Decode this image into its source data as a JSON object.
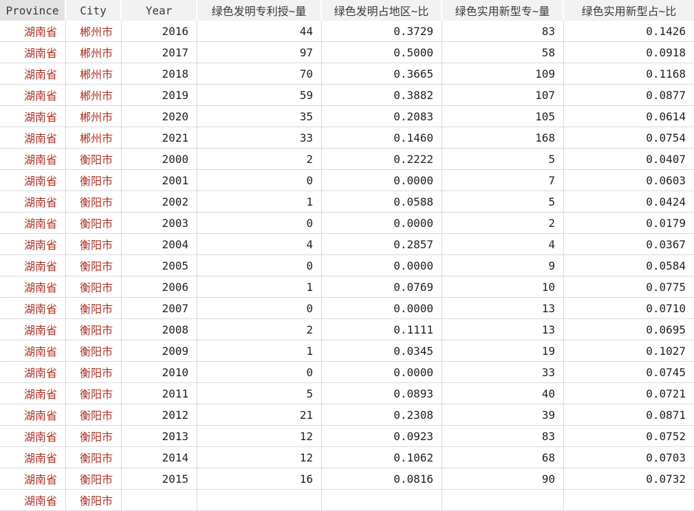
{
  "table": {
    "columns": [
      {
        "key": "province",
        "label": "Province"
      },
      {
        "key": "city",
        "label": "City"
      },
      {
        "key": "year",
        "label": "Year"
      },
      {
        "key": "green_invention_grants",
        "label": "绿色发明专利授~量"
      },
      {
        "key": "green_invention_share",
        "label": "绿色发明占地区~比"
      },
      {
        "key": "green_utility_grants",
        "label": "绿色实用新型专~量"
      },
      {
        "key": "green_utility_share",
        "label": "绿色实用新型占~比"
      }
    ],
    "rows": [
      {
        "province": "湖南省",
        "city": "郴州市",
        "year": "2016",
        "green_invention_grants": "44",
        "green_invention_share": "0.3729",
        "green_utility_grants": "83",
        "green_utility_share": "0.1426"
      },
      {
        "province": "湖南省",
        "city": "郴州市",
        "year": "2017",
        "green_invention_grants": "97",
        "green_invention_share": "0.5000",
        "green_utility_grants": "58",
        "green_utility_share": "0.0918"
      },
      {
        "province": "湖南省",
        "city": "郴州市",
        "year": "2018",
        "green_invention_grants": "70",
        "green_invention_share": "0.3665",
        "green_utility_grants": "109",
        "green_utility_share": "0.1168"
      },
      {
        "province": "湖南省",
        "city": "郴州市",
        "year": "2019",
        "green_invention_grants": "59",
        "green_invention_share": "0.3882",
        "green_utility_grants": "107",
        "green_utility_share": "0.0877"
      },
      {
        "province": "湖南省",
        "city": "郴州市",
        "year": "2020",
        "green_invention_grants": "35",
        "green_invention_share": "0.2083",
        "green_utility_grants": "105",
        "green_utility_share": "0.0614"
      },
      {
        "province": "湖南省",
        "city": "郴州市",
        "year": "2021",
        "green_invention_grants": "33",
        "green_invention_share": "0.1460",
        "green_utility_grants": "168",
        "green_utility_share": "0.0754"
      },
      {
        "province": "湖南省",
        "city": "衡阳市",
        "year": "2000",
        "green_invention_grants": "2",
        "green_invention_share": "0.2222",
        "green_utility_grants": "5",
        "green_utility_share": "0.0407"
      },
      {
        "province": "湖南省",
        "city": "衡阳市",
        "year": "2001",
        "green_invention_grants": "0",
        "green_invention_share": "0.0000",
        "green_utility_grants": "7",
        "green_utility_share": "0.0603"
      },
      {
        "province": "湖南省",
        "city": "衡阳市",
        "year": "2002",
        "green_invention_grants": "1",
        "green_invention_share": "0.0588",
        "green_utility_grants": "5",
        "green_utility_share": "0.0424"
      },
      {
        "province": "湖南省",
        "city": "衡阳市",
        "year": "2003",
        "green_invention_grants": "0",
        "green_invention_share": "0.0000",
        "green_utility_grants": "2",
        "green_utility_share": "0.0179"
      },
      {
        "province": "湖南省",
        "city": "衡阳市",
        "year": "2004",
        "green_invention_grants": "4",
        "green_invention_share": "0.2857",
        "green_utility_grants": "4",
        "green_utility_share": "0.0367"
      },
      {
        "province": "湖南省",
        "city": "衡阳市",
        "year": "2005",
        "green_invention_grants": "0",
        "green_invention_share": "0.0000",
        "green_utility_grants": "9",
        "green_utility_share": "0.0584"
      },
      {
        "province": "湖南省",
        "city": "衡阳市",
        "year": "2006",
        "green_invention_grants": "1",
        "green_invention_share": "0.0769",
        "green_utility_grants": "10",
        "green_utility_share": "0.0775"
      },
      {
        "province": "湖南省",
        "city": "衡阳市",
        "year": "2007",
        "green_invention_grants": "0",
        "green_invention_share": "0.0000",
        "green_utility_grants": "13",
        "green_utility_share": "0.0710"
      },
      {
        "province": "湖南省",
        "city": "衡阳市",
        "year": "2008",
        "green_invention_grants": "2",
        "green_invention_share": "0.1111",
        "green_utility_grants": "13",
        "green_utility_share": "0.0695"
      },
      {
        "province": "湖南省",
        "city": "衡阳市",
        "year": "2009",
        "green_invention_grants": "1",
        "green_invention_share": "0.0345",
        "green_utility_grants": "19",
        "green_utility_share": "0.1027"
      },
      {
        "province": "湖南省",
        "city": "衡阳市",
        "year": "2010",
        "green_invention_grants": "0",
        "green_invention_share": "0.0000",
        "green_utility_grants": "33",
        "green_utility_share": "0.0745"
      },
      {
        "province": "湖南省",
        "city": "衡阳市",
        "year": "2011",
        "green_invention_grants": "5",
        "green_invention_share": "0.0893",
        "green_utility_grants": "40",
        "green_utility_share": "0.0721"
      },
      {
        "province": "湖南省",
        "city": "衡阳市",
        "year": "2012",
        "green_invention_grants": "21",
        "green_invention_share": "0.2308",
        "green_utility_grants": "39",
        "green_utility_share": "0.0871"
      },
      {
        "province": "湖南省",
        "city": "衡阳市",
        "year": "2013",
        "green_invention_grants": "12",
        "green_invention_share": "0.0923",
        "green_utility_grants": "83",
        "green_utility_share": "0.0752"
      },
      {
        "province": "湖南省",
        "city": "衡阳市",
        "year": "2014",
        "green_invention_grants": "12",
        "green_invention_share": "0.1062",
        "green_utility_grants": "68",
        "green_utility_share": "0.0703"
      },
      {
        "province": "湖南省",
        "city": "衡阳市",
        "year": "2015",
        "green_invention_grants": "16",
        "green_invention_share": "0.0816",
        "green_utility_grants": "90",
        "green_utility_share": "0.0732"
      }
    ],
    "partial_next_row": {
      "province": "湖南省",
      "city": "衡阳市",
      "year": "",
      "green_invention_grants": "",
      "green_invention_share": "",
      "green_utility_grants": "",
      "green_utility_share": ""
    },
    "colors": {
      "string_text": "#a93226",
      "number_text": "#1f1f1f",
      "header_bg": "#f2f2f2",
      "header_bg_selected": "#e3e3e3",
      "grid_line": "#d9d9d9"
    }
  }
}
